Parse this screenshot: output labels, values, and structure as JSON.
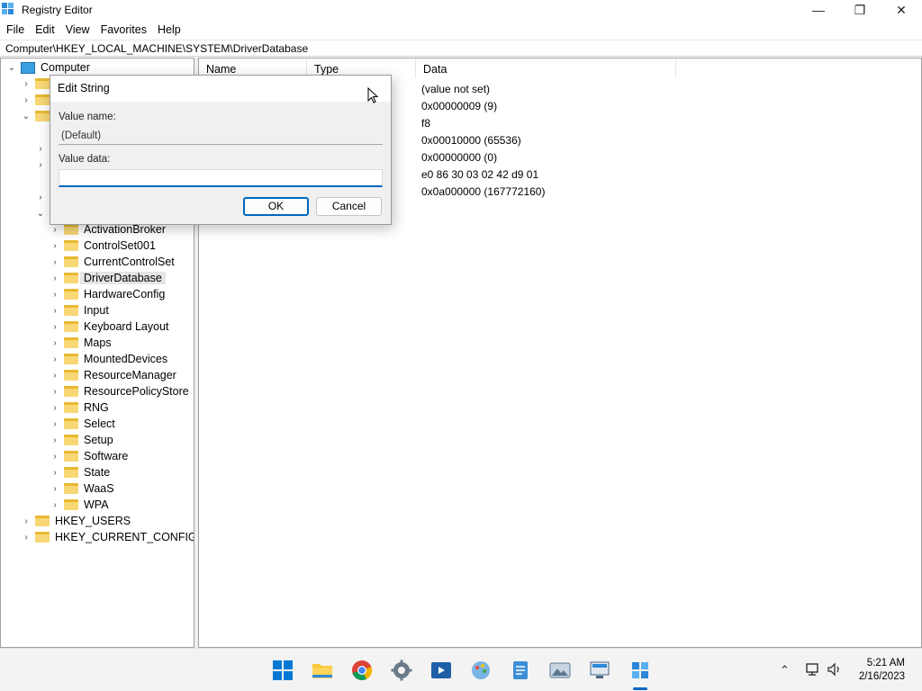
{
  "window": {
    "title": "Registry Editor",
    "controls": {
      "minimize": "—",
      "maximize": "❐",
      "close": "✕"
    }
  },
  "menu": [
    "File",
    "Edit",
    "View",
    "Favorites",
    "Help"
  ],
  "address": "Computer\\HKEY_LOCAL_MACHINE\\SYSTEM\\DriverDatabase",
  "tree": {
    "root": "Computer",
    "system_children": [
      "ActivationBroker",
      "ControlSet001",
      "CurrentControlSet",
      "DriverDatabase",
      "HardwareConfig",
      "Input",
      "Keyboard Layout",
      "Maps",
      "MountedDevices",
      "ResourceManager",
      "ResourcePolicyStore",
      "RNG",
      "Select",
      "Setup",
      "Software",
      "State",
      "WaaS",
      "WPA"
    ],
    "hives_bottom": [
      "HKEY_USERS",
      "HKEY_CURRENT_CONFIG"
    ],
    "selected": "DriverDatabase"
  },
  "list": {
    "columns": [
      "Name",
      "Type",
      "Data"
    ],
    "data_values": [
      "(value not set)",
      "0x00000009 (9)",
      "f8",
      "0x00010000 (65536)",
      "0x00000000 (0)",
      "e0 86 30 03 02 42 d9 01",
      "0x0a000000 (167772160)"
    ]
  },
  "dialog": {
    "title": "Edit String",
    "value_name_label": "Value name:",
    "value_name": "(Default)",
    "value_data_label": "Value data:",
    "value_data": "",
    "ok_label": "OK",
    "cancel_label": "Cancel"
  },
  "taskbar": {
    "icons": [
      "start-icon",
      "file-explorer-icon",
      "chrome-icon",
      "settings-icon",
      "media-player-icon",
      "paint-icon",
      "notepad-icon",
      "photos-icon",
      "remote-desktop-icon",
      "registry-editor-icon"
    ],
    "time": "5:21 AM",
    "date": "2/16/2023"
  },
  "colors": {
    "accent": "#0067c0",
    "folder": "#f8d775",
    "selection": "#e5e5e5"
  }
}
